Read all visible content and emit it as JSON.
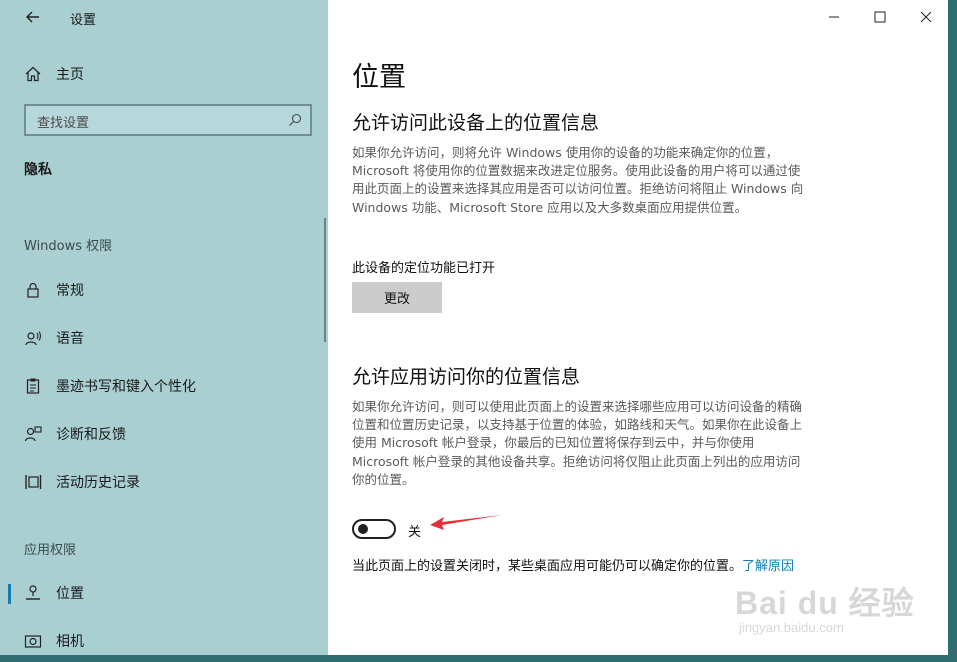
{
  "window": {
    "title": "设置"
  },
  "sidebar": {
    "home": "主页",
    "search_placeholder": "查找设置",
    "category": "隐私",
    "sections": {
      "windows_perms": "Windows 权限",
      "app_perms": "应用权限"
    },
    "items": [
      {
        "label": "常规",
        "icon": "lock-icon"
      },
      {
        "label": "语音",
        "icon": "speech-icon"
      },
      {
        "label": "墨迹书写和键入个性化",
        "icon": "clipboard-icon"
      },
      {
        "label": "诊断和反馈",
        "icon": "feedback-icon"
      },
      {
        "label": "活动历史记录",
        "icon": "activity-icon"
      },
      {
        "label": "位置",
        "icon": "location-icon",
        "active": true
      },
      {
        "label": "相机",
        "icon": "camera-icon"
      }
    ]
  },
  "main": {
    "title": "位置",
    "section1": {
      "heading": "允许访问此设备上的位置信息",
      "description": "如果你允许访问，则将允许 Windows 使用你的设备的功能来确定你的位置，Microsoft 将使用你的位置数据来改进定位服务。使用此设备的用户将可以通过使用此页面上的设置来选择其应用是否可以访问位置。拒绝访问将阻止 Windows 向 Windows 功能、Microsoft Store 应用以及大多数桌面应用提供位置。",
      "status": "此设备的定位功能已打开",
      "change_button": "更改"
    },
    "section2": {
      "heading": "允许应用访问你的位置信息",
      "description": "如果你允许访问，则可以使用此页面上的设置来选择哪些应用可以访问设备的精确位置和位置历史记录，以支持基于位置的体验，如路线和天气。如果你在此设备上使用 Microsoft 帐户登录，你最后的已知位置将保存到云中，并与你使用 Microsoft 帐户登录的其他设备共享。拒绝访问将仅阻止此页面上列出的应用访问你的位置。",
      "toggle_label": "关",
      "toggle_on": false
    },
    "note": {
      "text": "当此页面上的设置关闭时，某些桌面应用可能仍可以确定你的位置。",
      "link": "了解原因"
    }
  },
  "watermark": {
    "main": "Bai du 经验",
    "sub": "jingyan.baidu.com"
  },
  "colors": {
    "sidebar_bg": "#a9cfd1",
    "accent": "#1a7ab0",
    "link": "#0f7fb3",
    "arrow": "#e0303a"
  }
}
